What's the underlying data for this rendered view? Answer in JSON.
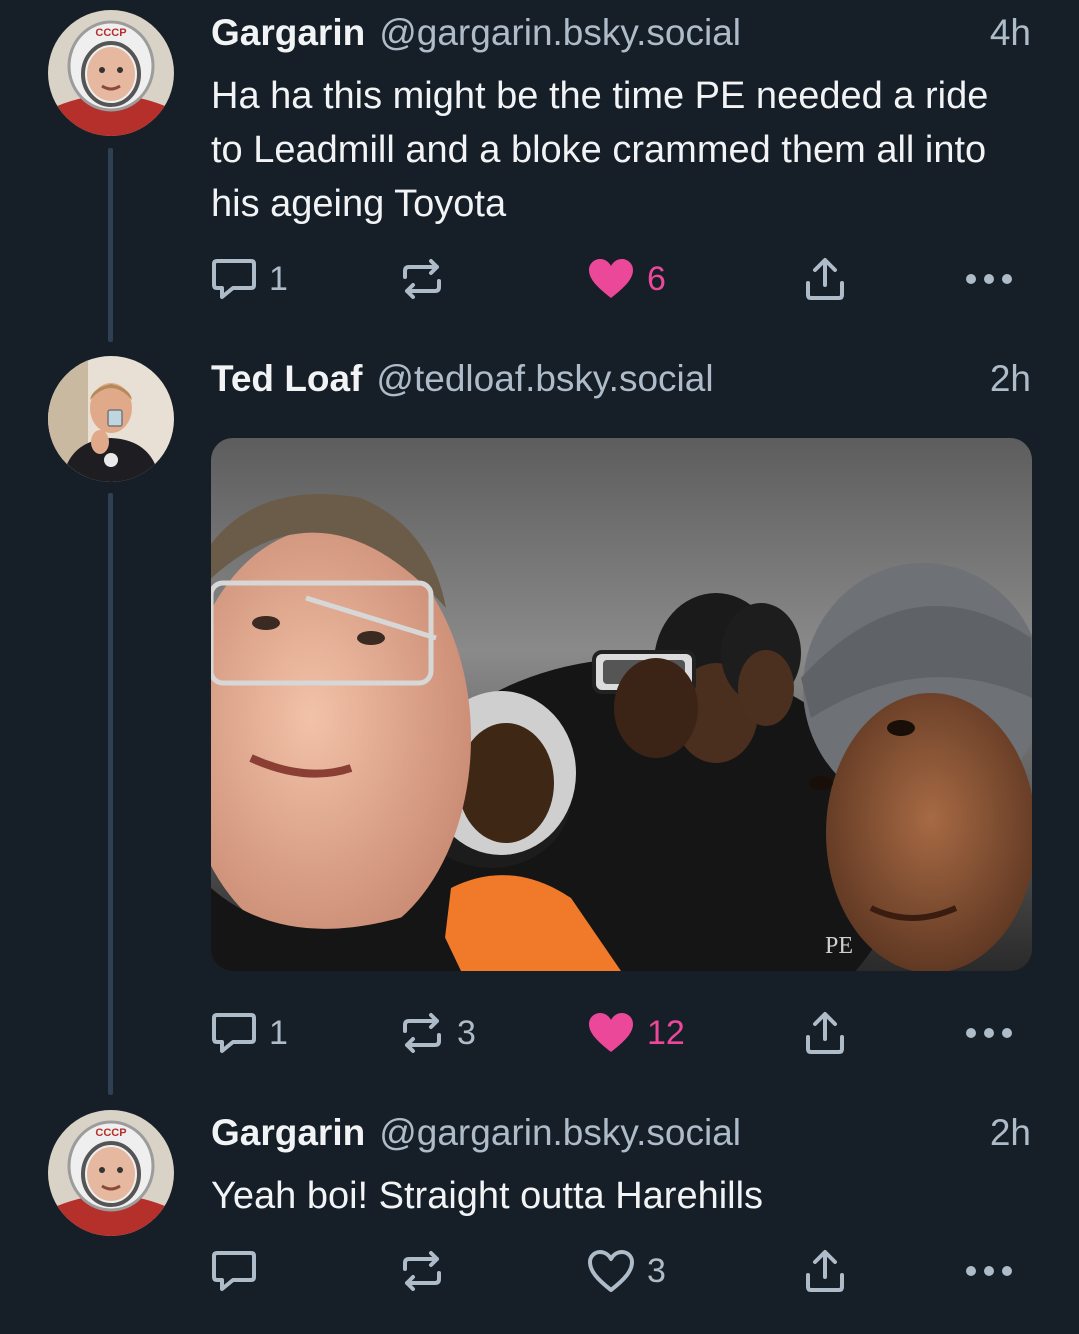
{
  "posts": [
    {
      "display_name": "Gargarin",
      "handle": "@gargarin.bsky.social",
      "time": "4h",
      "text": "Ha ha this might be the time PE needed a ride to Leadmill and a bloke crammed them all into his ageing Toyota",
      "reply_count": "1",
      "repost_count": "",
      "like_count": "6",
      "liked": true,
      "avatar_icon": "cosmonaut-avatar"
    },
    {
      "display_name": "Ted Loaf",
      "handle": "@tedloaf.bsky.social",
      "time": "2h",
      "text": "",
      "reply_count": "1",
      "repost_count": "3",
      "like_count": "12",
      "liked": true,
      "avatar_icon": "man-drinking-avatar",
      "media_icon": "car-selfie-photo",
      "media_caption": "PE"
    },
    {
      "display_name": "Gargarin",
      "handle": "@gargarin.bsky.social",
      "time": "2h",
      "text": "Yeah boi! Straight outta Harehills",
      "reply_count": "",
      "repost_count": "",
      "like_count": "3",
      "liked": false,
      "avatar_icon": "cosmonaut-avatar"
    }
  ],
  "icons": {
    "reply": "speech-bubble-icon",
    "repost": "repost-arrows-icon",
    "like": "heart-icon",
    "share": "share-upload-icon",
    "more": "ellipsis-icon"
  },
  "colors": {
    "background": "#161e27",
    "text": "#f1f3f5",
    "muted": "#aebbc9",
    "like": "#ec4899",
    "thread_line": "#2e4052"
  }
}
